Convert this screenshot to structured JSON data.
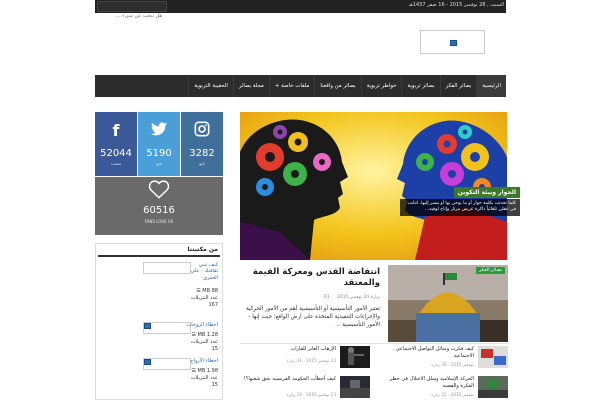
{
  "topbar": {
    "date": "السبت , 28 نوفمبر 2015 - 16 صفر 1437هـ",
    "search_placeholder": "هل تبحث عن شيء ..."
  },
  "nav": {
    "items": [
      "الرئيسية",
      "بصائر الفكر",
      "بصائر تربوية",
      "خواطر تربوية",
      "بصائر من واقعنا",
      "ملفات خاصة +",
      "مجلة بصائر",
      "الحقيبة التربوية"
    ]
  },
  "social": {
    "facebook": {
      "count": "52044",
      "label": "معجب"
    },
    "twitter": {
      "count": "5190",
      "label": "تابع"
    },
    "instagram": {
      "count": "3282",
      "label": "تابع"
    }
  },
  "fans": {
    "count": "60516",
    "label": "FANS LOVE US"
  },
  "library": {
    "title": "من مكتبتنا",
    "books": [
      {
        "title": "كيف تبني ثقافتك - علي العمري",
        "size": "MB 88 ☰",
        "downloads_label": "عدد التنزيلات",
        "downloads": "167"
      },
      {
        "title": "أخطاء الزوجات",
        "size": "MB 1.28 ☰",
        "downloads_label": "عدد التنزيلات",
        "downloads": "15"
      },
      {
        "title": "أخطاء الأزواج",
        "size": "MB 1.98 ☰",
        "downloads_label": "عدد التنزيلات",
        "downloads": "15"
      }
    ]
  },
  "slider": {
    "caption_title": "الحوار وبيئة التكوين",
    "caption_text": "كلما تحدثت بكلمة حوار أو ما يوحي بها أو يشير إليها، انتابت في عقلي تلقائياً ذاكرة عريض مرتل وإتاح لوقيه..."
  },
  "featured": {
    "title": "انتفاضة القدس ومعركة القيمة والمعتقد",
    "date": "24 نوفمبر 2015",
    "views": "61 زيارة",
    "excerpt": "تعتبر الأمور التأسيسية أو التأسيسية أهم من الأمور الحركية والإجراءات التنفيذية المتخذة على أرض الواقع؛ حيث إنها - الأمور التأسيسية ...",
    "tag": "بصائر الفكر"
  },
  "small_items": [
    {
      "title": "الإرهاب العابر للقارات",
      "meta": "23 نوفمبر 2015 · 31 زيارة"
    },
    {
      "title": "كيف أخطأت الحكومة الفرنسية بحق شعبها؟!",
      "meta": "23 نوفمبر 2015 · 24 زيارة"
    },
    {
      "title": "كيف فكرت وسائل التواصل الاجتماعي الاجتماعية",
      "meta": "نوفمبر 2015 · 26 زيارة"
    },
    {
      "title": "الحركة الإسلامية وشلل الاحتلال في حظر الفكرة والقضية",
      "meta": "نوفمبر 2015 · 22 زيارة"
    }
  ],
  "colors": {
    "facebook": "#3b5998",
    "twitter": "#4a9fd8",
    "instagram": "#3f6f9a",
    "fans": "#6a6a6a",
    "nav": "#2c2c2c",
    "slider_bg": "#f2c21c",
    "tag": "#2a9a3e"
  }
}
